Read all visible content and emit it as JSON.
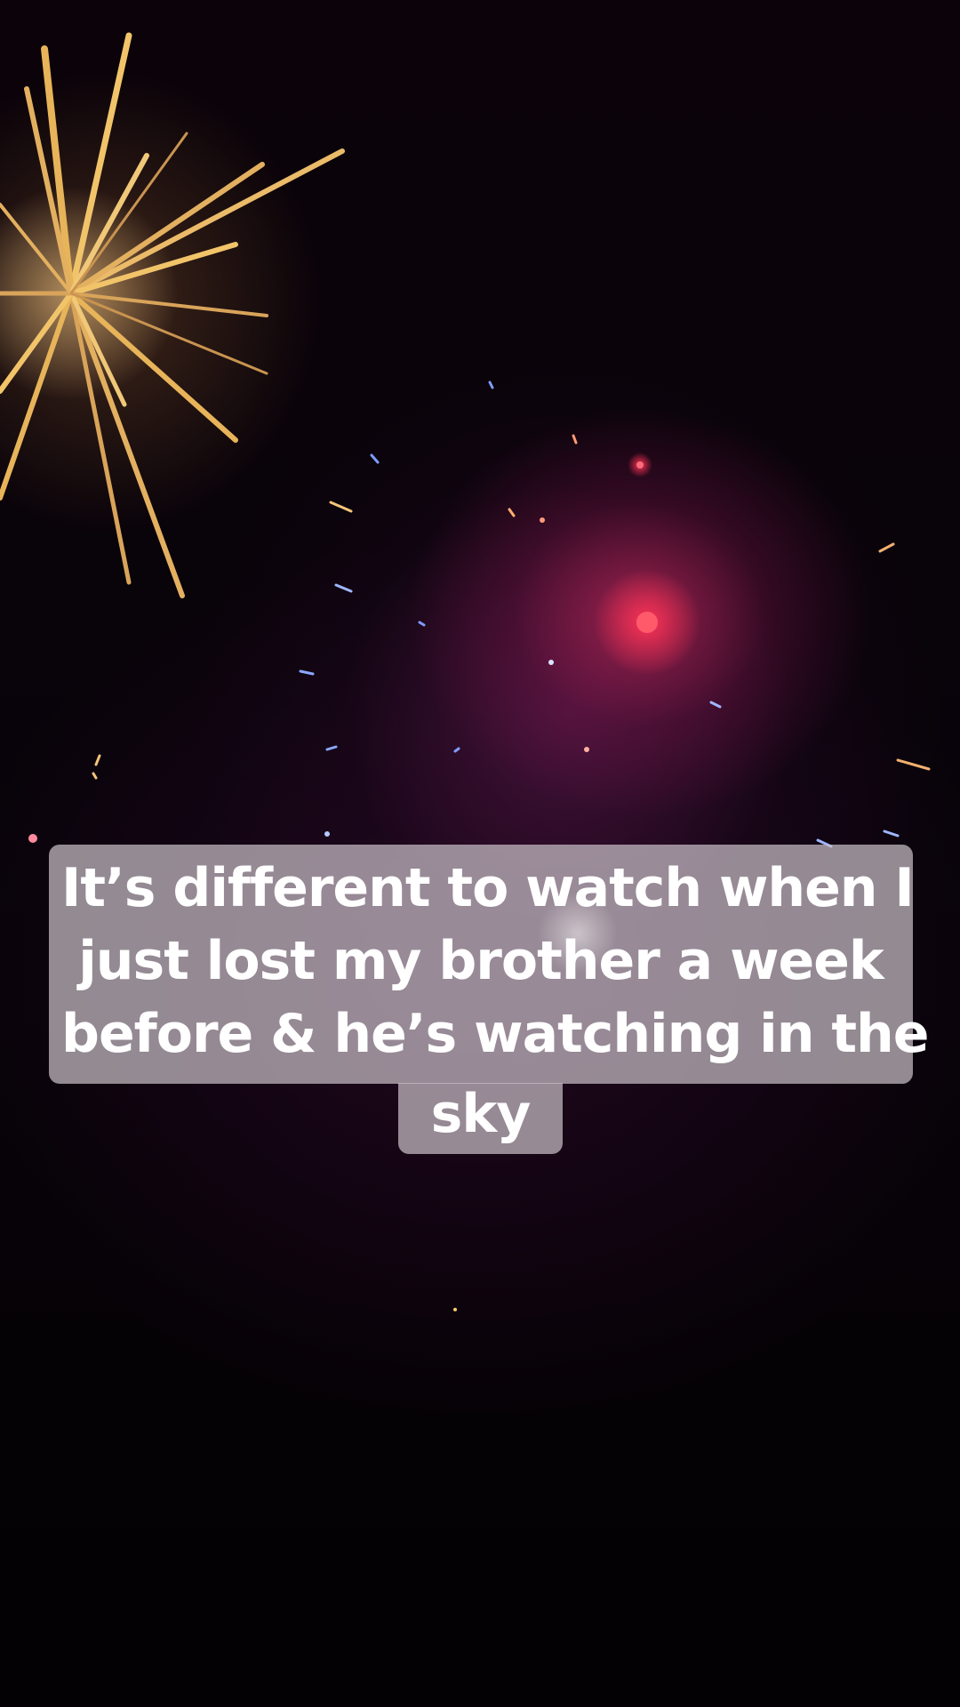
{
  "caption": {
    "lines": [
      "It’s different to watch when I",
      "just lost my brother a week",
      "before & he’s watching in the",
      "sky"
    ]
  }
}
